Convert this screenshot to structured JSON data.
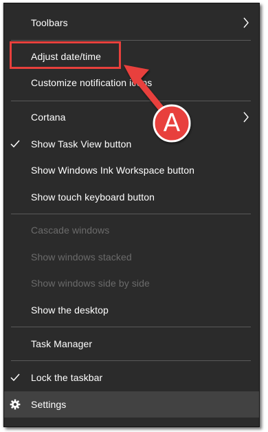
{
  "menu": {
    "items": [
      {
        "label": "Toolbars",
        "enabled": true,
        "submenu": true,
        "checked": false
      },
      {
        "label": "Adjust date/time",
        "enabled": true,
        "submenu": false,
        "checked": false
      },
      {
        "label": "Customize notification icons",
        "enabled": true,
        "submenu": false,
        "checked": false
      },
      {
        "label": "Cortana",
        "enabled": true,
        "submenu": true,
        "checked": false
      },
      {
        "label": "Show Task View button",
        "enabled": true,
        "submenu": false,
        "checked": true
      },
      {
        "label": "Show Windows Ink Workspace button",
        "enabled": true,
        "submenu": false,
        "checked": false
      },
      {
        "label": "Show touch keyboard button",
        "enabled": true,
        "submenu": false,
        "checked": false
      },
      {
        "label": "Cascade windows",
        "enabled": false,
        "submenu": false,
        "checked": false
      },
      {
        "label": "Show windows stacked",
        "enabled": false,
        "submenu": false,
        "checked": false
      },
      {
        "label": "Show windows side by side",
        "enabled": false,
        "submenu": false,
        "checked": false
      },
      {
        "label": "Show the desktop",
        "enabled": true,
        "submenu": false,
        "checked": false
      },
      {
        "label": "Task Manager",
        "enabled": true,
        "submenu": false,
        "checked": false
      },
      {
        "label": "Lock the taskbar",
        "enabled": true,
        "submenu": false,
        "checked": true
      },
      {
        "label": "Settings",
        "enabled": true,
        "submenu": false,
        "checked": false,
        "icon": "gear-icon",
        "hovered": true
      }
    ]
  },
  "annotation": {
    "label": "A",
    "color": "#e8403c"
  },
  "colors": {
    "menu_bg": "#2b2b2b",
    "text": "#ffffff",
    "disabled_text": "#6b6b6b",
    "separator": "#5a5a5a",
    "hover_bg": "#424242"
  }
}
